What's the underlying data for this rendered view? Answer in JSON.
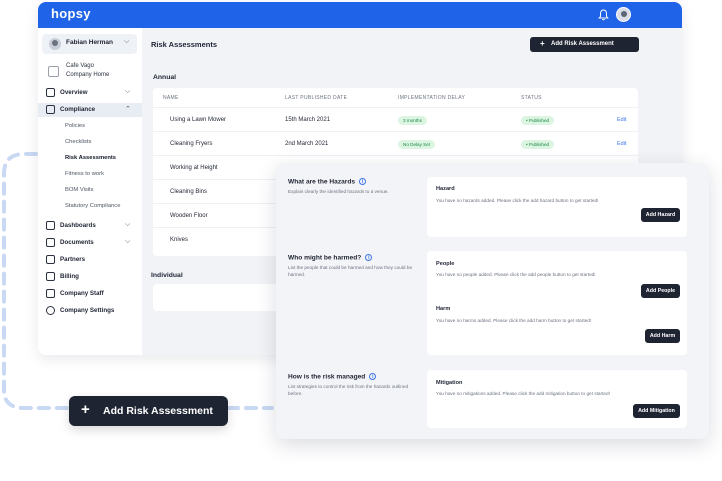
{
  "app": {
    "logo": "hopsy",
    "colors": {
      "brand": "#1f63e8",
      "dark": "#1f2433",
      "success_bg": "#dcf5e3",
      "success_text": "#1b8a43",
      "link": "#3b73e8"
    }
  },
  "sidebar": {
    "user_name": "Fabian Herman",
    "company_line1": "Cafe Vago",
    "company_line2": "Company Home",
    "items": [
      {
        "label": "Overview",
        "icon": "home-icon"
      },
      {
        "label": "Compliance",
        "icon": "clipboard-icon"
      },
      {
        "label": "Dashboards",
        "icon": "grid-icon"
      },
      {
        "label": "Documents",
        "icon": "document-icon"
      },
      {
        "label": "Partners",
        "icon": "partners-icon"
      },
      {
        "label": "Billing",
        "icon": "billing-icon"
      },
      {
        "label": "Company Staff",
        "icon": "staff-icon"
      },
      {
        "label": "Company Settings",
        "icon": "gear-icon"
      }
    ],
    "compliance_sub": [
      "Policies",
      "Checklists",
      "Risk Assessments",
      "Fitness to work",
      "BOM Visits",
      "Statutory Compliance"
    ]
  },
  "main": {
    "title": "Risk Assessments",
    "add_button": "Add Risk Assessment",
    "annual_label": "Annual",
    "individual_label": "Individual",
    "columns": [
      "NAME",
      "LAST PUBLISHED DATE",
      "IMPLEMENTATION DELAY",
      "STATUS"
    ],
    "rows": [
      {
        "name": "Using a Lawn Mower",
        "date": "15th March 2021",
        "delay": "3 months",
        "status": "Published",
        "action": "Edit"
      },
      {
        "name": "Cleaning Fryers",
        "date": "2nd March 2021",
        "delay": "No Delay Set",
        "status": "Published",
        "action": "Edit"
      },
      {
        "name": "Working at Height"
      },
      {
        "name": "Cleaning Bins"
      },
      {
        "name": "Wooden Floor"
      },
      {
        "name": "Knives"
      }
    ]
  },
  "panel": {
    "hazards": {
      "title": "What are the Hazards",
      "desc": "Explain clearly the identified hazards to a venue.",
      "label": "Hazard",
      "empty": "You have no hazards added. Please click the add hazard button to get started!",
      "button": "Add Hazard"
    },
    "harmed": {
      "title": "Who might be harmed?",
      "desc": "List the people that could be harmed and how they could be harmed.",
      "people_label": "People",
      "people_empty": "You have no people added. Please click the add people button to get started!",
      "people_button": "Add People",
      "harm_label": "Harm",
      "harm_empty": "You have no harms added. Please click the add harm button to get started!",
      "harm_button": "Add Harm"
    },
    "managed": {
      "title": "How is the risk managed",
      "desc": "List strategies to control the risk from the hazards outlined before.",
      "label": "Mitigation",
      "empty": "You have no mitigations added. Please click the add mitigation button to get started!",
      "button": "Add Mitigation"
    }
  },
  "cta": {
    "label": "Add Risk Assessment"
  }
}
